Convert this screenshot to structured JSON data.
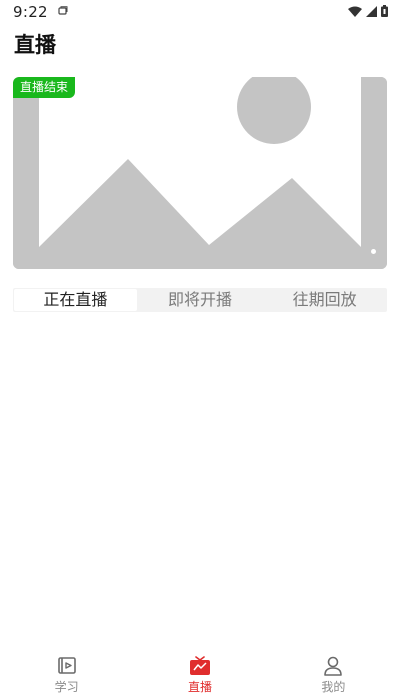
{
  "status_bar": {
    "time": "9:22",
    "icons": [
      "notification-icon",
      "wifi-icon",
      "signal-icon",
      "battery-icon"
    ]
  },
  "header": {
    "title": "直播"
  },
  "banner": {
    "badge": "直播结束",
    "badge_color": "#19b81c",
    "image_icon": "image-placeholder-icon",
    "page_indicator_count": 1
  },
  "tabs": [
    {
      "label": "正在直播",
      "active": true
    },
    {
      "label": "即将开播",
      "active": false
    },
    {
      "label": "往期回放",
      "active": false
    }
  ],
  "bottom_nav": [
    {
      "label": "学习",
      "icon": "video-play-icon",
      "active": false
    },
    {
      "label": "直播",
      "icon": "tv-icon",
      "active": true
    },
    {
      "label": "我的",
      "icon": "user-icon",
      "active": false
    }
  ],
  "colors": {
    "accent": "#e02d2d",
    "inactive": "#8a8a8a"
  }
}
